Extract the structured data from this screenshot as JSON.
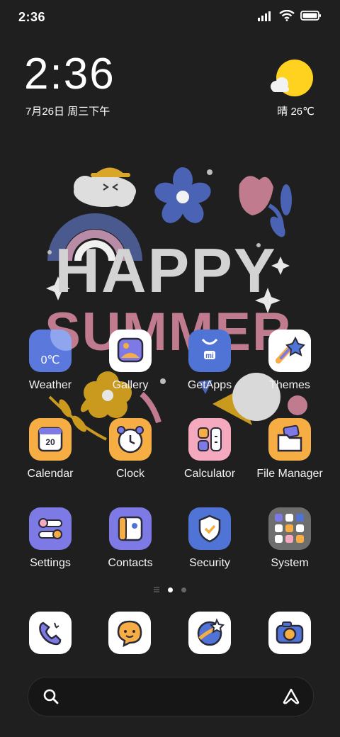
{
  "status_bar": {
    "time": "2:36"
  },
  "lock_widget": {
    "time": "2:36",
    "date": "7月26日 周三下午"
  },
  "weather_widget": {
    "summary": "晴 26℃"
  },
  "wallpaper": {
    "line1": "HAPPY",
    "line2": "SUMMER"
  },
  "apps": [
    {
      "label": "Weather",
      "badge": "0℃"
    },
    {
      "label": "Gallery"
    },
    {
      "label": "GetApps"
    },
    {
      "label": "Themes"
    },
    {
      "label": "Calendar",
      "badge": "20"
    },
    {
      "label": "Clock"
    },
    {
      "label": "Calculator"
    },
    {
      "label": "File Manager"
    },
    {
      "label": "Settings"
    },
    {
      "label": "Contacts"
    },
    {
      "label": "Security"
    },
    {
      "label": "System"
    }
  ],
  "page_indicator": {
    "current": 1,
    "total": 2
  },
  "dock": [
    {
      "icon": "phone-icon"
    },
    {
      "icon": "messages-icon"
    },
    {
      "icon": "browser-icon"
    },
    {
      "icon": "camera-icon"
    }
  ],
  "search": {
    "icons": [
      "search-icon",
      "assistant-icon"
    ]
  },
  "colors": {
    "background": "#1f1f1f",
    "icon_purple": "#7d7ae6",
    "icon_orange": "#f6ad43",
    "icon_blue": "#4f74d6"
  }
}
